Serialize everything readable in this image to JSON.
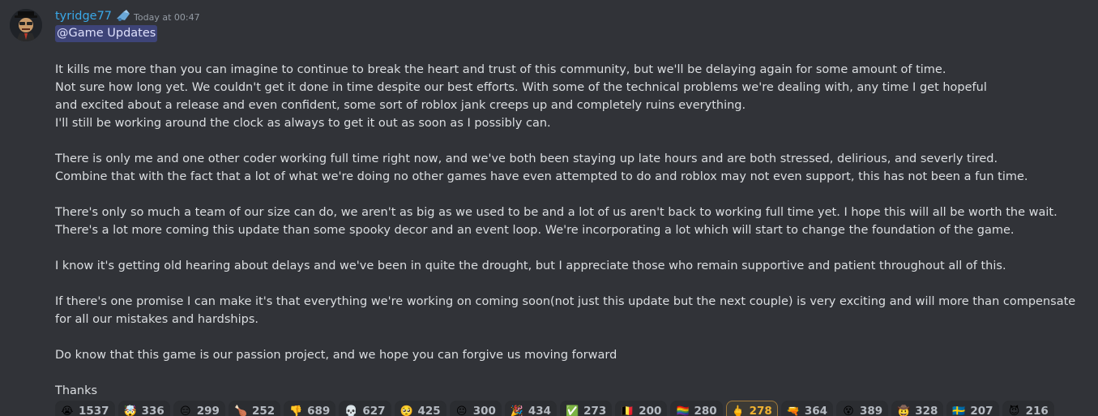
{
  "message": {
    "username": "tyridge77",
    "timestamp": "Today at 00:47",
    "mention": "@Game Updates",
    "colors": {
      "background": "#313338",
      "username": "#3aa8e8",
      "mention_bg": "#4e5396",
      "reaction_bg": "#2b2d31",
      "reaction_active_border": "#a0793a",
      "reaction_active_count": "#f0b232"
    },
    "paragraphs": [
      "It kills me more than you can imagine to continue to break the heart and trust of this community, but we'll be delaying again for some amount of time.",
      "Not sure how long yet. We couldn't get it done in time despite our best efforts. With some of the technical problems we're dealing with, any time I get hopeful",
      "and excited about a release and even confident, some sort of roblox jank creeps up and completely ruins everything.",
      "I'll still be working around the clock as always to get it out as soon as I possibly can.",
      "",
      "There is only me and one other coder working full time right now, and we've both been staying up late hours and are both stressed, delirious, and severly tired.",
      "Combine that with the fact that a lot of what we're doing no other games have even attempted to do and roblox may not even support, this has not been a fun time.",
      "",
      "There's only so much a team of our size can do, we aren't as big as we used to be and a lot of us aren't back to working full time yet. I hope this will all be worth the wait.",
      "There's a lot more coming this update than some spooky decor and an event loop. We're incorporating a lot which will start to change the foundation of the game.",
      "",
      "I know it's getting old hearing about delays and we've been in quite the drought, but I appreciate those who remain supportive and patient throughout all of this.",
      "",
      "If there's one promise I can make it's that everything we're working on coming soon(not just this update but the next couple) is very exciting and will more than compensate for all our mistakes and hardships.",
      "",
      "Do know that this game is our passion project, and we hope you can forgive us moving forward",
      "",
      "Thanks"
    ],
    "reactions": [
      {
        "emoji": "😭",
        "icon": "crying-face-icon",
        "count": "1537",
        "me": false
      },
      {
        "emoji": "🤯",
        "icon": "exploding-head-icon",
        "count": "336",
        "me": false
      },
      {
        "emoji": "😑",
        "icon": "meme-face-icon",
        "count": "299",
        "me": false
      },
      {
        "emoji": "🍗",
        "icon": "drumstick-icon",
        "count": "252",
        "me": false
      },
      {
        "emoji": "👎",
        "icon": "thumbs-down-icon",
        "count": "689",
        "me": false
      },
      {
        "emoji": "💀",
        "icon": "skull-icon",
        "count": "627",
        "me": false
      },
      {
        "emoji": "🥺",
        "icon": "pleading-face-icon",
        "count": "425",
        "me": false
      },
      {
        "emoji": "😐",
        "icon": "meme-face-2-icon",
        "count": "300",
        "me": false
      },
      {
        "emoji": "🎉",
        "icon": "party-icon",
        "count": "434",
        "me": false
      },
      {
        "emoji": "✅",
        "icon": "check-mark-icon",
        "count": "273",
        "me": false
      },
      {
        "emoji": "🇧🇪",
        "icon": "flag-icon",
        "count": "200",
        "me": false
      },
      {
        "emoji": "🏳️‍🌈",
        "icon": "rainbow-flag-icon",
        "count": "280",
        "me": false
      },
      {
        "emoji": "🖕",
        "icon": "hand-gesture-icon",
        "count": "278",
        "me": true
      },
      {
        "emoji": "🔫",
        "icon": "gun-icon",
        "count": "364",
        "me": false
      },
      {
        "emoji": "😵",
        "icon": "dizzy-face-icon",
        "count": "389",
        "me": false
      },
      {
        "emoji": "🤠",
        "icon": "cowboy-face-icon",
        "count": "328",
        "me": false
      },
      {
        "emoji": "🇸🇪",
        "icon": "sweden-flag-icon",
        "count": "207",
        "me": false
      },
      {
        "emoji": "😈",
        "icon": "devil-face-icon",
        "count": "216",
        "me": false
      }
    ]
  }
}
